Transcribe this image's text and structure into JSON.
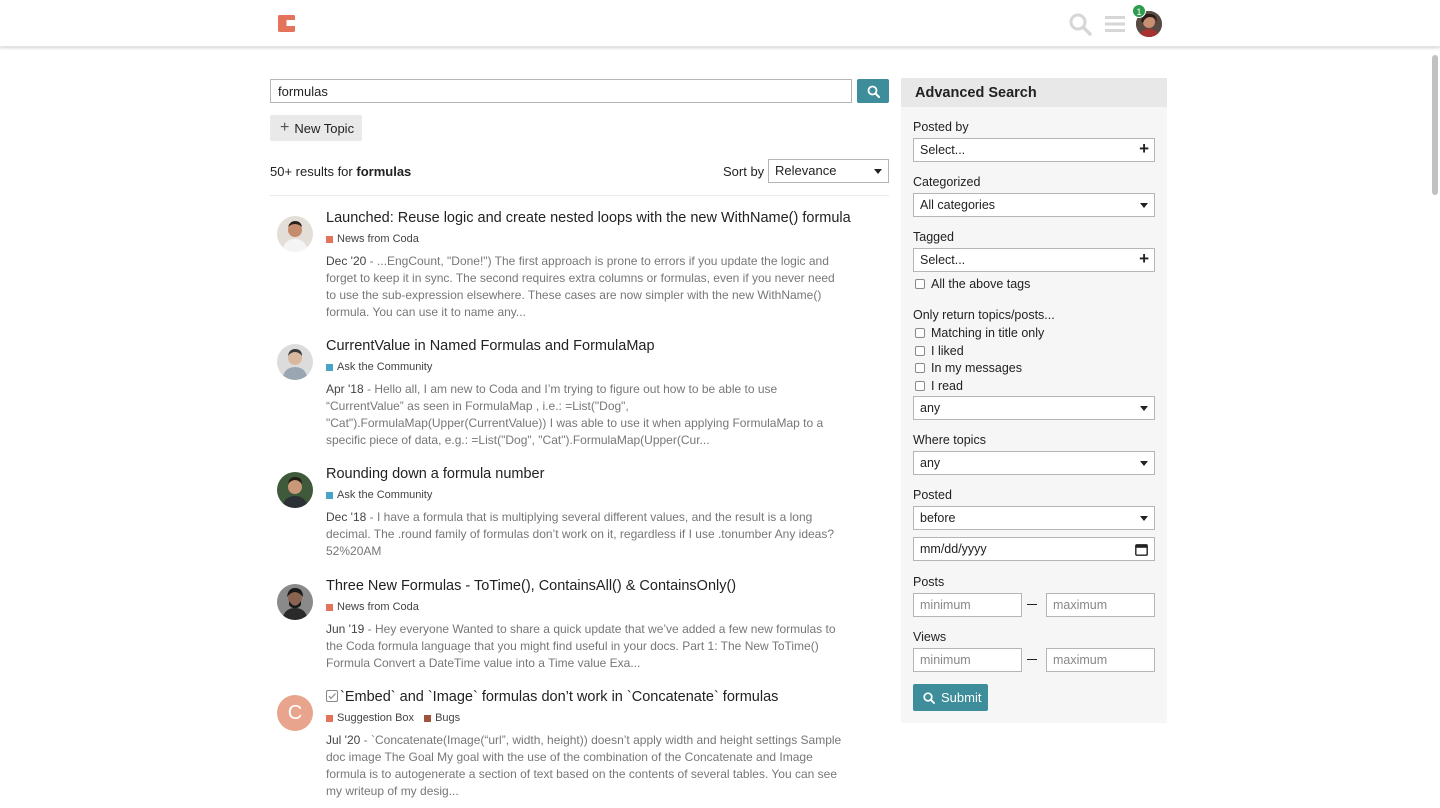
{
  "colors": {
    "accent": "#3d8d9b",
    "logo": "#e5735b",
    "badge": "#2d9c4c",
    "news_from_coda": "#e5735b",
    "ask_the_community": "#48a3c7",
    "suggestion_box": "#e5735b",
    "bugs": "#a0533d"
  },
  "header": {
    "notification_count": "1",
    "icons": [
      "coda-logo-icon",
      "search-icon",
      "hamburger-menu-icon",
      "user-avatar"
    ]
  },
  "search": {
    "query": "formulas",
    "new_topic_label": "New Topic",
    "results_prefix": "50+ results for",
    "results_term": "formulas",
    "sort_label": "Sort by",
    "sort_value": "Relevance"
  },
  "results": [
    {
      "title": "Launched: Reuse logic and create nested loops with the new WithName() formula",
      "categories": [
        {
          "name": "News from Coda",
          "color": "#e5735b"
        }
      ],
      "date": "Dec '20",
      "blurb": "...EngCount, \"Done!\") The first approach is prone to errors if you update the logic and forget to keep it in sync. The second requires extra columns or formulas, even if you never need to use the sub-expression elsewhere. These cases are now simpler with the new WithName() formula. You can use it to name any..."
    },
    {
      "title": "CurrentValue in Named Formulas and FormulaMap",
      "categories": [
        {
          "name": "Ask the Community",
          "color": "#48a3c7"
        }
      ],
      "date": "Apr '18",
      "blurb": "Hello all, I am new to Coda and I’m trying to figure out how to be able to use “CurrentValue” as seen in FormulaMap , i.e.: =List(\"Dog\", \"Cat\").FormulaMap(Upper(CurrentValue)) I was able to use it when applying FormulaMap to a specific piece of data, e.g.: =List(\"Dog\", \"Cat\").FormulaMap(Upper(Cur..."
    },
    {
      "title": "Rounding down a formula number",
      "categories": [
        {
          "name": "Ask the Community",
          "color": "#48a3c7"
        }
      ],
      "date": "Dec '18",
      "blurb": "I have a formula that is multiplying several different values, and the result is a long decimal. The .round family of formulas don’t work on it, regardless if I use .tonumber Any ideas? 52%20AM"
    },
    {
      "title": "Three New Formulas - ToTime(), ContainsAll() & ContainsOnly()",
      "categories": [
        {
          "name": "News from Coda",
          "color": "#e5735b"
        }
      ],
      "date": "Jun '19",
      "blurb": "Hey everyone Wanted to share a quick update that we’ve added a few new formulas to the Coda formula language that you might find useful in your docs. Part 1: The New ToTime() Formula Convert a DateTime value into a Time value Exa..."
    },
    {
      "title": "`Embed` and `Image` formulas don’t work in `Concatenate` formulas",
      "avatar_letter": "C",
      "categories": [
        {
          "name": "Suggestion Box",
          "color": "#e5735b"
        },
        {
          "name": "Bugs",
          "color": "#a0533d"
        }
      ],
      "date": "Jul '20",
      "blurb": "`Concatenate(Image(“url”, width, height)) doesn’t apply width and height settings Sample doc image The Goal My goal with the use of the combination of the Concatenate and Image formula is to autogenerate a section of text based on the contents of several tables. You can see my writeup of my desig..."
    }
  ],
  "advanced": {
    "heading": "Advanced Search",
    "posted_by_label": "Posted by",
    "posted_by_value": "Select...",
    "categorized_label": "Categorized",
    "categorized_value": "All categories",
    "tagged_label": "Tagged",
    "tagged_value": "Select...",
    "all_tags_label": "All the above tags",
    "only_return_label": "Only return topics/posts...",
    "matching_title_label": "Matching in title only",
    "liked_label": "I liked",
    "messages_label": "In my messages",
    "read_label": "I read",
    "only_return_value": "any",
    "where_topics_label": "Where topics",
    "where_topics_value": "any",
    "posted_label": "Posted",
    "posted_value": "before",
    "date_placeholder": "mm/dd/yyyy",
    "posts_label": "Posts",
    "views_label": "Views",
    "min_placeholder": "minimum",
    "max_placeholder": "maximum",
    "submit_label": "Submit"
  }
}
